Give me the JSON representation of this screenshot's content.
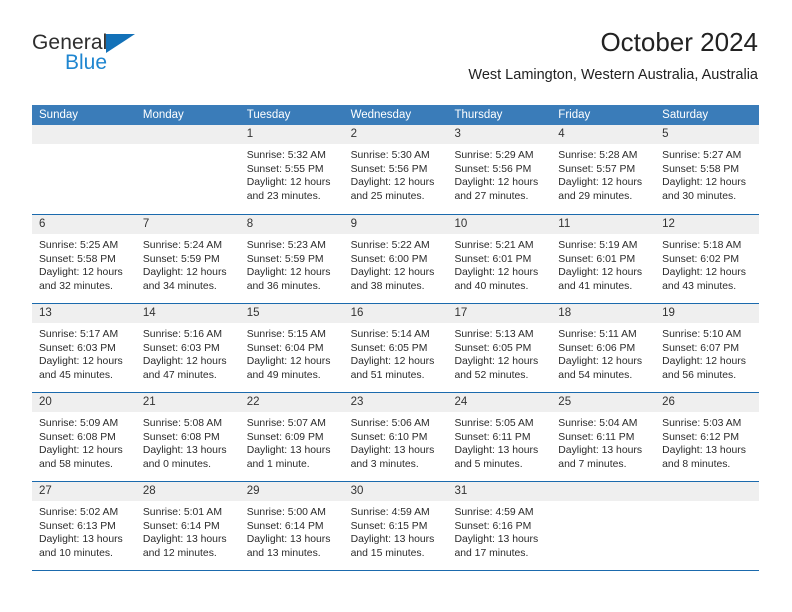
{
  "brand": {
    "name_top": "General",
    "name_bottom": "Blue",
    "triangle_color": "#1371b8",
    "blue_text_color": "#1f86d0"
  },
  "header": {
    "title": "October 2024",
    "location": "West Lamington, Western Australia, Australia"
  },
  "theme": {
    "header_blue": "#3a7cb9",
    "rule_blue": "#1b6aad",
    "day_band_gray": "#efefef"
  },
  "weekday_headers": [
    "Sunday",
    "Monday",
    "Tuesday",
    "Wednesday",
    "Thursday",
    "Friday",
    "Saturday"
  ],
  "weeks": [
    [
      {
        "day": "",
        "empty": true
      },
      {
        "day": "",
        "empty": true
      },
      {
        "day": "1",
        "sunrise": "Sunrise: 5:32 AM",
        "sunset": "Sunset: 5:55 PM",
        "daylight_1": "Daylight: 12 hours",
        "daylight_2": "and 23 minutes."
      },
      {
        "day": "2",
        "sunrise": "Sunrise: 5:30 AM",
        "sunset": "Sunset: 5:56 PM",
        "daylight_1": "Daylight: 12 hours",
        "daylight_2": "and 25 minutes."
      },
      {
        "day": "3",
        "sunrise": "Sunrise: 5:29 AM",
        "sunset": "Sunset: 5:56 PM",
        "daylight_1": "Daylight: 12 hours",
        "daylight_2": "and 27 minutes."
      },
      {
        "day": "4",
        "sunrise": "Sunrise: 5:28 AM",
        "sunset": "Sunset: 5:57 PM",
        "daylight_1": "Daylight: 12 hours",
        "daylight_2": "and 29 minutes."
      },
      {
        "day": "5",
        "sunrise": "Sunrise: 5:27 AM",
        "sunset": "Sunset: 5:58 PM",
        "daylight_1": "Daylight: 12 hours",
        "daylight_2": "and 30 minutes."
      }
    ],
    [
      {
        "day": "6",
        "sunrise": "Sunrise: 5:25 AM",
        "sunset": "Sunset: 5:58 PM",
        "daylight_1": "Daylight: 12 hours",
        "daylight_2": "and 32 minutes."
      },
      {
        "day": "7",
        "sunrise": "Sunrise: 5:24 AM",
        "sunset": "Sunset: 5:59 PM",
        "daylight_1": "Daylight: 12 hours",
        "daylight_2": "and 34 minutes."
      },
      {
        "day": "8",
        "sunrise": "Sunrise: 5:23 AM",
        "sunset": "Sunset: 5:59 PM",
        "daylight_1": "Daylight: 12 hours",
        "daylight_2": "and 36 minutes."
      },
      {
        "day": "9",
        "sunrise": "Sunrise: 5:22 AM",
        "sunset": "Sunset: 6:00 PM",
        "daylight_1": "Daylight: 12 hours",
        "daylight_2": "and 38 minutes."
      },
      {
        "day": "10",
        "sunrise": "Sunrise: 5:21 AM",
        "sunset": "Sunset: 6:01 PM",
        "daylight_1": "Daylight: 12 hours",
        "daylight_2": "and 40 minutes."
      },
      {
        "day": "11",
        "sunrise": "Sunrise: 5:19 AM",
        "sunset": "Sunset: 6:01 PM",
        "daylight_1": "Daylight: 12 hours",
        "daylight_2": "and 41 minutes."
      },
      {
        "day": "12",
        "sunrise": "Sunrise: 5:18 AM",
        "sunset": "Sunset: 6:02 PM",
        "daylight_1": "Daylight: 12 hours",
        "daylight_2": "and 43 minutes."
      }
    ],
    [
      {
        "day": "13",
        "sunrise": "Sunrise: 5:17 AM",
        "sunset": "Sunset: 6:03 PM",
        "daylight_1": "Daylight: 12 hours",
        "daylight_2": "and 45 minutes."
      },
      {
        "day": "14",
        "sunrise": "Sunrise: 5:16 AM",
        "sunset": "Sunset: 6:03 PM",
        "daylight_1": "Daylight: 12 hours",
        "daylight_2": "and 47 minutes."
      },
      {
        "day": "15",
        "sunrise": "Sunrise: 5:15 AM",
        "sunset": "Sunset: 6:04 PM",
        "daylight_1": "Daylight: 12 hours",
        "daylight_2": "and 49 minutes."
      },
      {
        "day": "16",
        "sunrise": "Sunrise: 5:14 AM",
        "sunset": "Sunset: 6:05 PM",
        "daylight_1": "Daylight: 12 hours",
        "daylight_2": "and 51 minutes."
      },
      {
        "day": "17",
        "sunrise": "Sunrise: 5:13 AM",
        "sunset": "Sunset: 6:05 PM",
        "daylight_1": "Daylight: 12 hours",
        "daylight_2": "and 52 minutes."
      },
      {
        "day": "18",
        "sunrise": "Sunrise: 5:11 AM",
        "sunset": "Sunset: 6:06 PM",
        "daylight_1": "Daylight: 12 hours",
        "daylight_2": "and 54 minutes."
      },
      {
        "day": "19",
        "sunrise": "Sunrise: 5:10 AM",
        "sunset": "Sunset: 6:07 PM",
        "daylight_1": "Daylight: 12 hours",
        "daylight_2": "and 56 minutes."
      }
    ],
    [
      {
        "day": "20",
        "sunrise": "Sunrise: 5:09 AM",
        "sunset": "Sunset: 6:08 PM",
        "daylight_1": "Daylight: 12 hours",
        "daylight_2": "and 58 minutes."
      },
      {
        "day": "21",
        "sunrise": "Sunrise: 5:08 AM",
        "sunset": "Sunset: 6:08 PM",
        "daylight_1": "Daylight: 13 hours",
        "daylight_2": "and 0 minutes."
      },
      {
        "day": "22",
        "sunrise": "Sunrise: 5:07 AM",
        "sunset": "Sunset: 6:09 PM",
        "daylight_1": "Daylight: 13 hours",
        "daylight_2": "and 1 minute."
      },
      {
        "day": "23",
        "sunrise": "Sunrise: 5:06 AM",
        "sunset": "Sunset: 6:10 PM",
        "daylight_1": "Daylight: 13 hours",
        "daylight_2": "and 3 minutes."
      },
      {
        "day": "24",
        "sunrise": "Sunrise: 5:05 AM",
        "sunset": "Sunset: 6:11 PM",
        "daylight_1": "Daylight: 13 hours",
        "daylight_2": "and 5 minutes."
      },
      {
        "day": "25",
        "sunrise": "Sunrise: 5:04 AM",
        "sunset": "Sunset: 6:11 PM",
        "daylight_1": "Daylight: 13 hours",
        "daylight_2": "and 7 minutes."
      },
      {
        "day": "26",
        "sunrise": "Sunrise: 5:03 AM",
        "sunset": "Sunset: 6:12 PM",
        "daylight_1": "Daylight: 13 hours",
        "daylight_2": "and 8 minutes."
      }
    ],
    [
      {
        "day": "27",
        "sunrise": "Sunrise: 5:02 AM",
        "sunset": "Sunset: 6:13 PM",
        "daylight_1": "Daylight: 13 hours",
        "daylight_2": "and 10 minutes."
      },
      {
        "day": "28",
        "sunrise": "Sunrise: 5:01 AM",
        "sunset": "Sunset: 6:14 PM",
        "daylight_1": "Daylight: 13 hours",
        "daylight_2": "and 12 minutes."
      },
      {
        "day": "29",
        "sunrise": "Sunrise: 5:00 AM",
        "sunset": "Sunset: 6:14 PM",
        "daylight_1": "Daylight: 13 hours",
        "daylight_2": "and 13 minutes."
      },
      {
        "day": "30",
        "sunrise": "Sunrise: 4:59 AM",
        "sunset": "Sunset: 6:15 PM",
        "daylight_1": "Daylight: 13 hours",
        "daylight_2": "and 15 minutes."
      },
      {
        "day": "31",
        "sunrise": "Sunrise: 4:59 AM",
        "sunset": "Sunset: 6:16 PM",
        "daylight_1": "Daylight: 13 hours",
        "daylight_2": "and 17 minutes."
      },
      {
        "day": "",
        "empty": true
      },
      {
        "day": "",
        "empty": true
      }
    ]
  ]
}
